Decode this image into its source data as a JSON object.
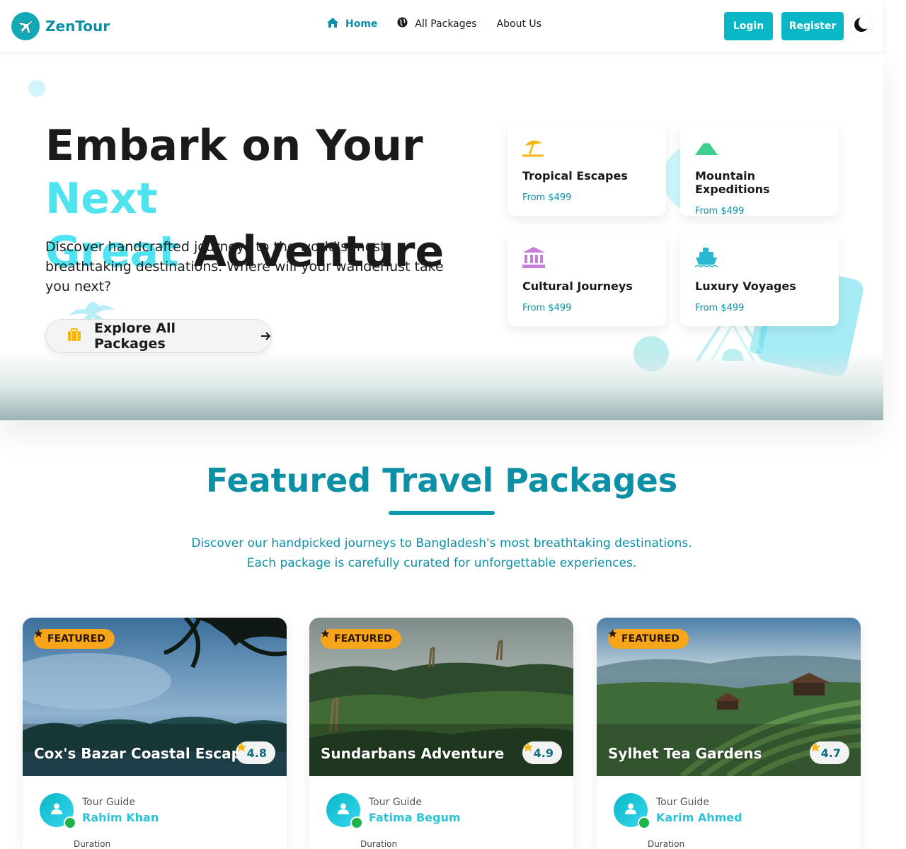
{
  "brand": {
    "name": "ZenTour"
  },
  "nav": {
    "links": [
      {
        "label": "Home",
        "icon": "home-icon",
        "active": true
      },
      {
        "label": "All Packages",
        "icon": "globe-icon",
        "active": false
      },
      {
        "label": "About Us",
        "icon": "",
        "active": false
      }
    ],
    "login_label": "Login",
    "register_label": "Register",
    "theme_icon": "moon-icon"
  },
  "hero": {
    "title_part1": "Embark on Your ",
    "title_accent1": "Next",
    "title_accent2": "Great",
    "title_part2": " Adventure",
    "subtitle": "Discover handcrafted journeys to the world's most breathtaking destinations. Where will your wanderlust take you next?",
    "cta_label": "Explore All Packages",
    "categories": [
      {
        "title": "Tropical Escapes",
        "price": "From $499",
        "icon": "beach-umbrella-icon"
      },
      {
        "title": "Mountain Expeditions",
        "price": "From $499",
        "icon": "mountain-icon"
      },
      {
        "title": "Cultural Journeys",
        "price": "From $499",
        "icon": "landmark-icon"
      },
      {
        "title": "Luxury Voyages",
        "price": "From $499",
        "icon": "ship-icon"
      }
    ]
  },
  "featured": {
    "title": "Featured Travel Packages",
    "description_line1": "Discover our handpicked journeys to Bangladesh's most breathtaking destinations.",
    "description_line2": "Each package is carefully curated for unforgettable experiences.",
    "packages": [
      {
        "badge": "FEATURED",
        "name": "Cox's Bazar Coastal Escape",
        "rating": "4.8",
        "guide_label": "Tour Guide",
        "guide_name": "Rahim Khan",
        "duration_label": "Duration"
      },
      {
        "badge": "FEATURED",
        "name": "Sundarbans Adventure",
        "rating": "4.9",
        "guide_label": "Tour Guide",
        "guide_name": "Fatima Begum",
        "duration_label": "Duration"
      },
      {
        "badge": "FEATURED",
        "name": "Sylhet Tea Gardens",
        "rating": "4.7",
        "guide_label": "Tour Guide",
        "guide_name": "Karim Ahmed",
        "duration_label": "Duration"
      }
    ]
  },
  "colors": {
    "primary": "#0d8fa6",
    "button": "#0ab7c6",
    "accent": "#4fe3f0",
    "badge": "#f7a51a",
    "online": "#1fb34a"
  }
}
